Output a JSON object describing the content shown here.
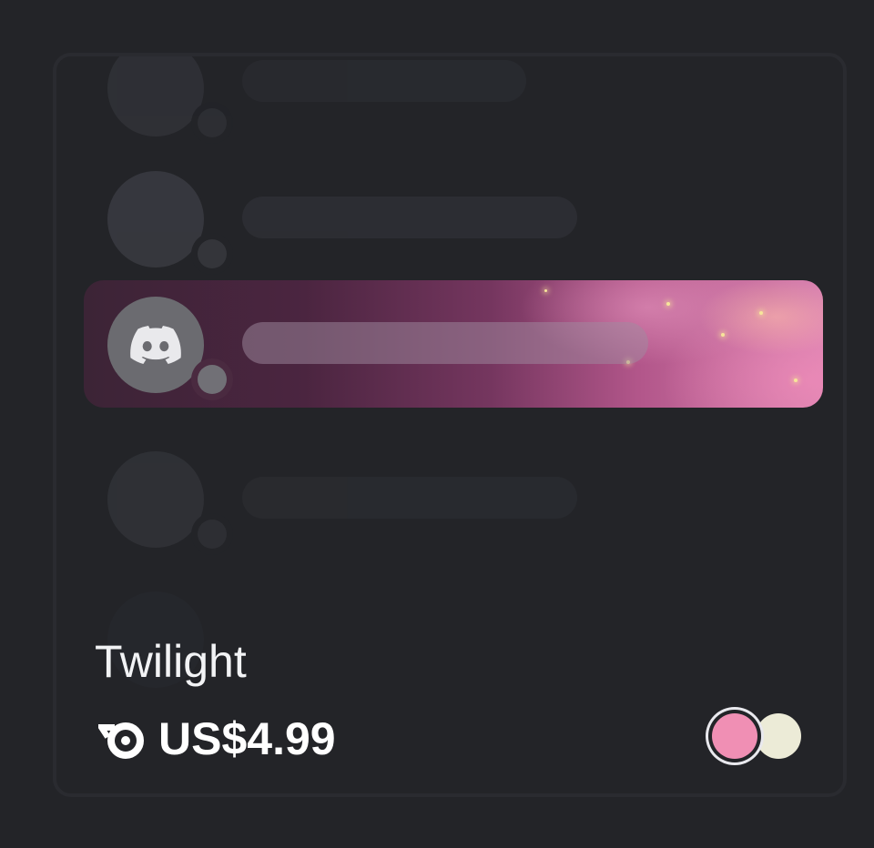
{
  "product": {
    "name": "Twilight",
    "price": "US$4.99",
    "currency_icon": "orb-icon"
  },
  "swatches": [
    {
      "name": "pink",
      "color": "#f08fb4",
      "selected": true
    },
    {
      "name": "cream",
      "color": "#ecebd7",
      "selected": false
    }
  ],
  "preview": {
    "featured_avatar_icon": "discord-logo-icon",
    "gradient_colors": [
      "#3c2436",
      "#75365f",
      "#d982b0"
    ]
  }
}
